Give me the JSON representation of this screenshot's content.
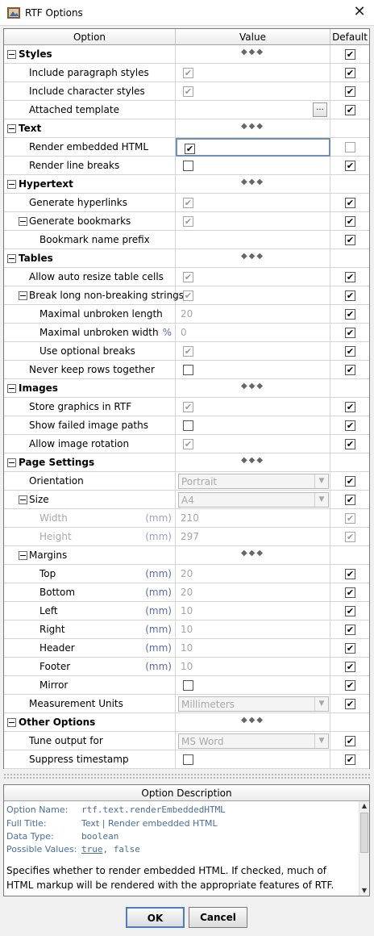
{
  "window": {
    "title": "RTF Options",
    "icon": "rtf-app-icon",
    "close_icon": "close-icon"
  },
  "table": {
    "headers": {
      "option": "Option",
      "value": "Value",
      "default": "Default"
    },
    "rows": [
      {
        "kind": "group",
        "label": "Styles",
        "value": "dots",
        "default": "checked"
      },
      {
        "kind": "opt",
        "level": 1,
        "label": "Include paragraph styles",
        "value": "cb-dim-checked",
        "default": "checked"
      },
      {
        "kind": "opt",
        "level": 1,
        "label": "Include character styles",
        "value": "cb-dim-checked",
        "default": "checked"
      },
      {
        "kind": "opt",
        "level": 1,
        "label": "Attached template",
        "value": "browse",
        "browse_label": "...",
        "default": "checked"
      },
      {
        "kind": "group",
        "label": "Text",
        "value": "dots",
        "default": "none"
      },
      {
        "kind": "opt",
        "level": 1,
        "label": "Render embedded HTML",
        "value": "cb-checked",
        "default": "unchecked-dim",
        "focused": true
      },
      {
        "kind": "opt",
        "level": 1,
        "label": "Render line breaks",
        "value": "cb-unchecked",
        "default": "checked"
      },
      {
        "kind": "group",
        "label": "Hypertext",
        "value": "dots",
        "default": "none"
      },
      {
        "kind": "opt",
        "level": 1,
        "label": "Generate hyperlinks",
        "value": "cb-dim-checked",
        "default": "checked"
      },
      {
        "kind": "subgroup",
        "level": 1,
        "label": "Generate bookmarks",
        "value": "cb-dim-checked",
        "default": "checked"
      },
      {
        "kind": "opt",
        "level": 2,
        "label": "Bookmark name prefix",
        "value": "empty",
        "default": "checked"
      },
      {
        "kind": "group",
        "label": "Tables",
        "value": "dots",
        "default": "none"
      },
      {
        "kind": "opt",
        "level": 1,
        "label": "Allow auto resize table cells",
        "value": "cb-dim-checked",
        "default": "checked"
      },
      {
        "kind": "subgroup",
        "level": 1,
        "label": "Break long non-breaking strings",
        "value": "cb-dim-checked",
        "default": "checked"
      },
      {
        "kind": "opt",
        "level": 2,
        "label": "Maximal unbroken length",
        "value": "text",
        "text": "20",
        "default": "checked"
      },
      {
        "kind": "opt",
        "level": 2,
        "label": "Maximal unbroken width",
        "unit": "%",
        "value": "text",
        "text": "0",
        "default": "checked"
      },
      {
        "kind": "opt",
        "level": 2,
        "label": "Use optional breaks",
        "value": "cb-dim-checked",
        "default": "checked"
      },
      {
        "kind": "opt",
        "level": 1,
        "label": "Never keep rows together",
        "value": "cb-unchecked",
        "default": "checked"
      },
      {
        "kind": "group",
        "label": "Images",
        "value": "dots",
        "default": "none"
      },
      {
        "kind": "opt",
        "level": 1,
        "label": "Store graphics in RTF",
        "value": "cb-dim-checked",
        "default": "checked"
      },
      {
        "kind": "opt",
        "level": 1,
        "label": "Show failed image paths",
        "value": "cb-unchecked",
        "default": "checked"
      },
      {
        "kind": "opt",
        "level": 1,
        "label": "Allow image rotation",
        "value": "cb-dim-checked",
        "default": "checked"
      },
      {
        "kind": "group",
        "label": "Page Settings",
        "value": "dots",
        "default": "none"
      },
      {
        "kind": "opt",
        "level": 1,
        "label": "Orientation",
        "value": "combo",
        "text": "Portrait",
        "default": "checked"
      },
      {
        "kind": "subgroup",
        "level": 1,
        "label": "Size",
        "value": "combo",
        "text": "A4",
        "default": "checked"
      },
      {
        "kind": "opt",
        "level": 2,
        "label": "Width",
        "unit": "(mm)",
        "disabled": true,
        "value": "text",
        "text": "210",
        "default": "checked-dim"
      },
      {
        "kind": "opt",
        "level": 2,
        "label": "Height",
        "unit": "(mm)",
        "disabled": true,
        "value": "text",
        "text": "297",
        "default": "checked-dim"
      },
      {
        "kind": "subgroup",
        "level": 1,
        "label": "Margins",
        "value": "dots",
        "default": "none"
      },
      {
        "kind": "opt",
        "level": 2,
        "label": "Top",
        "unit": "(mm)",
        "value": "text",
        "text": "20",
        "default": "checked"
      },
      {
        "kind": "opt",
        "level": 2,
        "label": "Bottom",
        "unit": "(mm)",
        "value": "text",
        "text": "20",
        "default": "checked"
      },
      {
        "kind": "opt",
        "level": 2,
        "label": "Left",
        "unit": "(mm)",
        "value": "text",
        "text": "10",
        "default": "checked"
      },
      {
        "kind": "opt",
        "level": 2,
        "label": "Right",
        "unit": "(mm)",
        "value": "text",
        "text": "10",
        "default": "checked"
      },
      {
        "kind": "opt",
        "level": 2,
        "label": "Header",
        "unit": "(mm)",
        "value": "text",
        "text": "10",
        "default": "checked"
      },
      {
        "kind": "opt",
        "level": 2,
        "label": "Footer",
        "unit": "(mm)",
        "value": "text",
        "text": "10",
        "default": "checked"
      },
      {
        "kind": "opt",
        "level": 2,
        "label": "Mirror",
        "value": "cb-unchecked",
        "default": "checked"
      },
      {
        "kind": "opt",
        "level": 1,
        "label": "Measurement Units",
        "value": "combo",
        "text": "Millimeters",
        "default": "checked"
      },
      {
        "kind": "group",
        "label": "Other Options",
        "value": "dots",
        "default": "none"
      },
      {
        "kind": "opt",
        "level": 1,
        "label": "Tune output for",
        "value": "combo",
        "text": "MS Word",
        "default": "checked"
      },
      {
        "kind": "opt",
        "level": 1,
        "label": "Suppress timestamp",
        "value": "cb-unchecked",
        "default": "checked"
      }
    ]
  },
  "description": {
    "header": "Option Description",
    "option_name_label": "Option Name:",
    "option_name": "rtf.text.renderEmbeddedHTML",
    "full_title_label": "Full Title:",
    "full_title": "Text | Render embedded HTML",
    "data_type_label": "Data Type:",
    "data_type": "boolean",
    "possible_values_label": "Possible Values:",
    "possible_true": "true",
    "possible_sep": ", false",
    "text": "Specifies whether to render embedded HTML. If checked, much of HTML markup will be rendered with the appropriate features of RTF."
  },
  "buttons": {
    "ok": "OK",
    "cancel": "Cancel"
  },
  "colors": {
    "focus_border": "#6e90b8",
    "desc_label": "#4a6da0",
    "unit": "#5a6ab0"
  }
}
